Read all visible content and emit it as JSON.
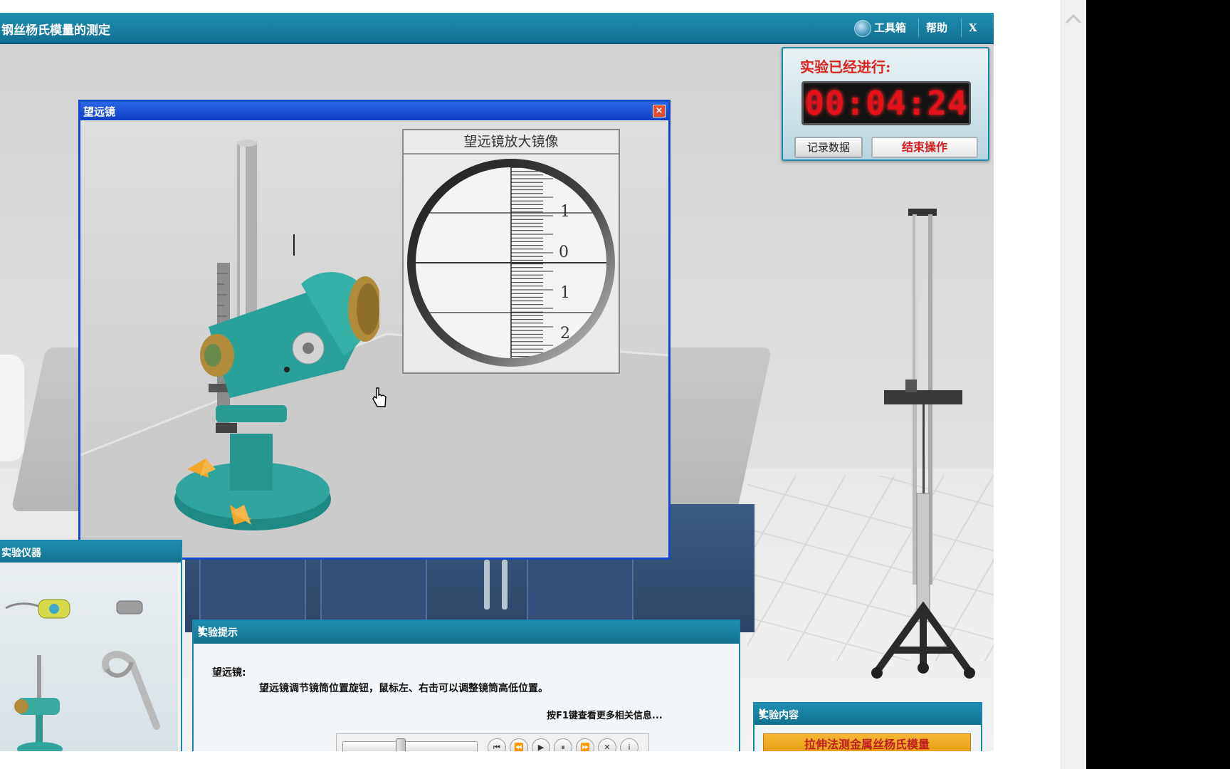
{
  "window": {
    "title": "钢丝杨氏模量的测定",
    "toolbox_label": "工具箱",
    "help_label": "帮助",
    "close_label": "X"
  },
  "timer": {
    "label": "实验已经进行:",
    "time": "00:04:24",
    "record_button": "记录数据",
    "end_button": "结束操作"
  },
  "telescope_dialog": {
    "title": "望远镜",
    "close_label": "×",
    "magnified_title": "望远镜放大镜像",
    "scale_labels": [
      "1",
      "0",
      "1",
      "2"
    ]
  },
  "instruments": {
    "title": "实验仪器",
    "items": [
      "tape-measure",
      "weight",
      "telescope",
      "clamp"
    ]
  },
  "hints": {
    "title": "实验提示",
    "collapse": "¥",
    "item_name": "望远镜:",
    "item_text": "望远镜调节镜筒位置旋钮，鼠标左、右击可以调整镜筒高低位置。",
    "more_info": "按F1键查看更多相关信息..."
  },
  "player": {
    "slider_value": 0.42,
    "buttons": [
      "first-icon",
      "rewind-icon",
      "play-icon",
      "pause-icon",
      "forward-icon",
      "stop-icon",
      "info-icon"
    ],
    "glyphs": [
      "⏮",
      "⏪",
      "▶",
      "⏸",
      "⏩",
      "✕",
      "i"
    ]
  },
  "content": {
    "title": "实验内容",
    "collapse": "¥",
    "item": "拉伸法测金属丝杨氏模量"
  },
  "colors": {
    "title_bar": "#1a82a8",
    "dialog_title": "#1647c8",
    "timer_digits": "#e5121b",
    "accent_orange": "#f2a62a"
  }
}
